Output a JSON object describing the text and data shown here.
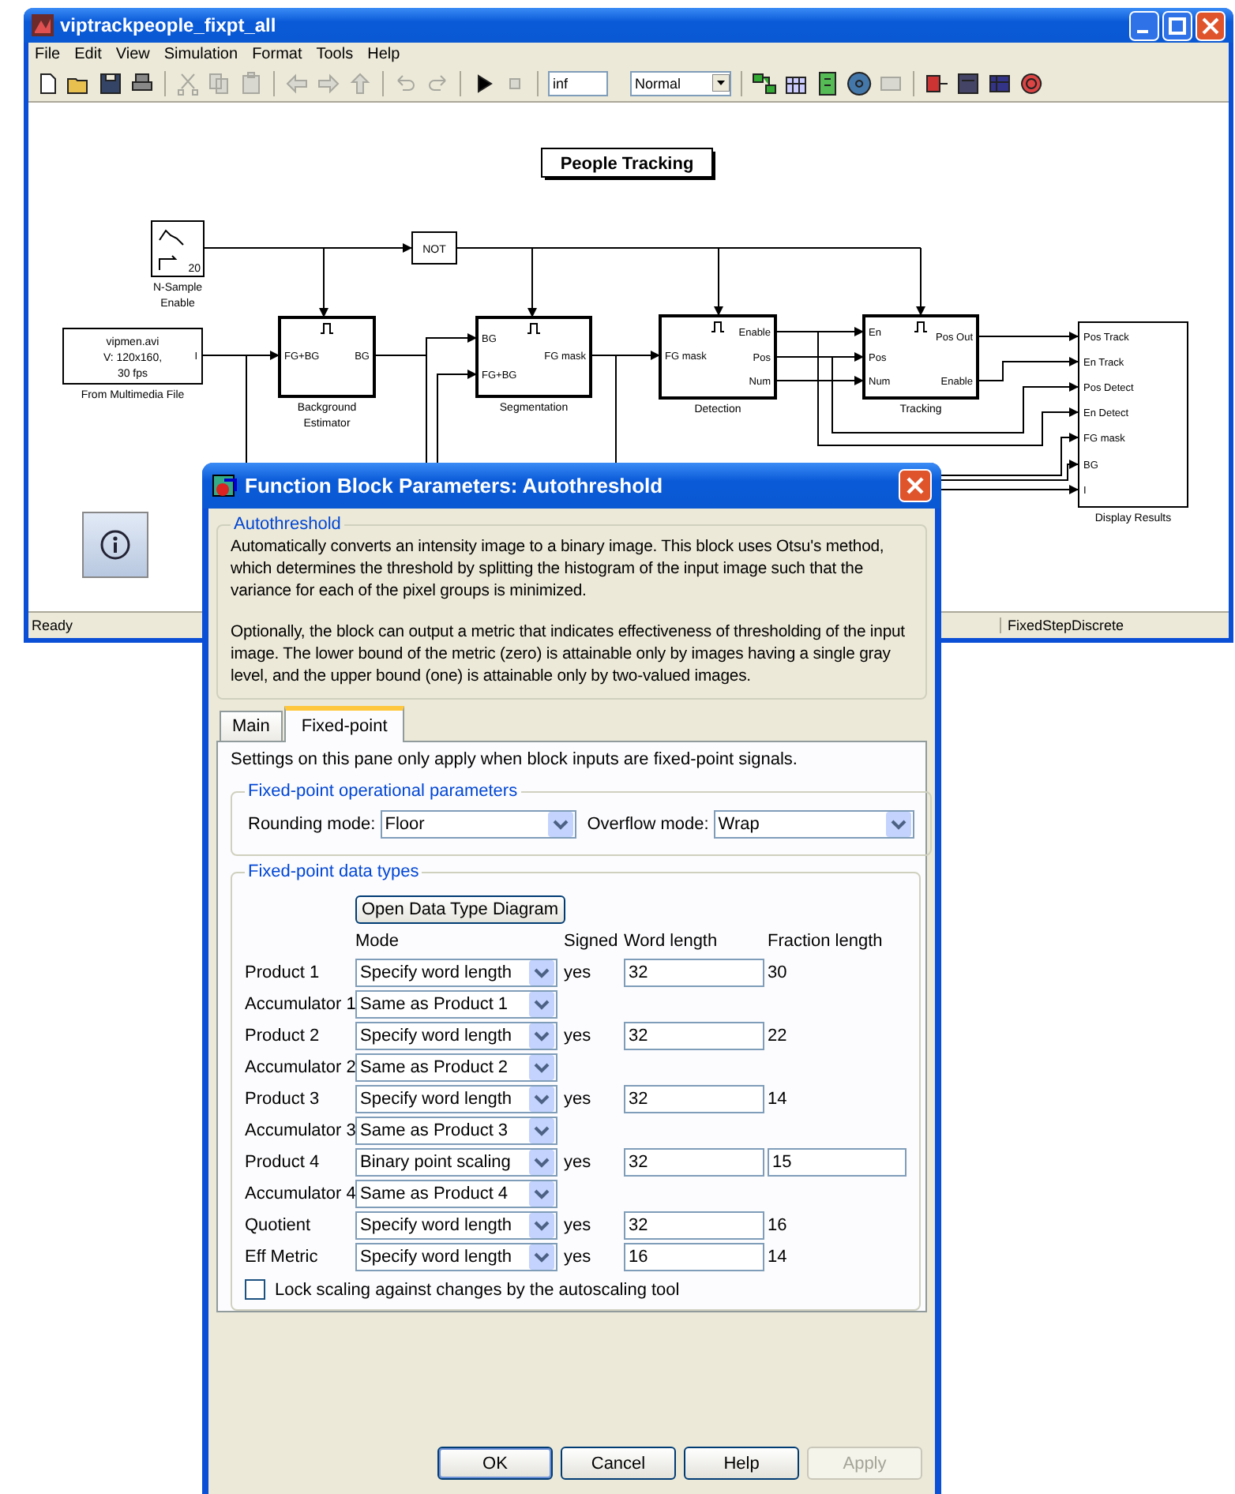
{
  "window": {
    "title": "viptrackpeople_fixpt_all"
  },
  "menu": [
    "File",
    "Edit",
    "View",
    "Simulation",
    "Format",
    "Tools",
    "Help"
  ],
  "toolbar": {
    "buttons": [
      {
        "disabled": false
      },
      {
        "disabled": false
      },
      {
        "disabled": false
      },
      {
        "disabled": false
      },
      {
        "disabled": true
      },
      {
        "disabled": true
      },
      {
        "disabled": true
      },
      {
        "disabled": true
      },
      {
        "disabled": true
      },
      {
        "disabled": true
      },
      {
        "disabled": true
      },
      {
        "disabled": true
      },
      {
        "disabled": false
      },
      {
        "disabled": true
      },
      {
        "disabled": false
      },
      {
        "disabled": false
      },
      {
        "disabled": false
      },
      {
        "disabled": false
      },
      {
        "disabled": true
      },
      {
        "disabled": false
      },
      {
        "disabled": false
      },
      {
        "disabled": false
      },
      {
        "disabled": false
      }
    ],
    "stop_time": "inf",
    "sim_mode": "Normal"
  },
  "diagram": {
    "annotation": "People Tracking",
    "blocks": [
      {
        "kind": "switch",
        "content": [
          "20"
        ],
        "caption": [
          "N-Sample",
          "Enable"
        ]
      },
      {
        "kind": "logic",
        "content": [
          "NOT"
        ]
      },
      {
        "kind": "source",
        "content": [
          "vipmen.avi",
          "V: 120x160,",
          "30 fps"
        ],
        "outputs": [
          "I"
        ],
        "caption": [
          "From Multimedia File"
        ]
      },
      {
        "kind": "subsystem",
        "enabled": true,
        "inputs": [
          "FG+BG"
        ],
        "outputs": [
          "BG"
        ],
        "caption": [
          "Background",
          "Estimator"
        ]
      },
      {
        "kind": "subsystem",
        "enabled": true,
        "inputs": [
          "BG",
          "FG+BG"
        ],
        "outputs": [
          "FG mask"
        ],
        "caption": [
          "Segmentation"
        ]
      },
      {
        "kind": "subsystem",
        "enabled": true,
        "inputs": [
          "FG mask"
        ],
        "outputs": [
          "Enable",
          "Pos",
          "Num"
        ],
        "caption": [
          "Detection"
        ]
      },
      {
        "kind": "subsystem",
        "enabled": true,
        "inputs": [
          "En",
          "Pos",
          "Num"
        ],
        "outputs": [
          "Pos Out",
          "Enable"
        ],
        "caption": [
          "Tracking"
        ]
      },
      {
        "kind": "sink",
        "inputs": [
          "Pos Track",
          "En Track",
          "Pos Detect",
          "En Detect",
          "FG mask",
          "BG",
          "I"
        ],
        "caption": [
          "Display Results"
        ]
      }
    ]
  },
  "status_bar": {
    "left": "Ready",
    "right": "FixedStepDiscrete"
  },
  "dialog": {
    "title": "Function Block Parameters: Autothreshold",
    "group_title": "Autothreshold",
    "paragraphs": [
      "Automatically converts an intensity image to a binary image.  This block uses Otsu's method, which determines the threshold by splitting the histogram of the input image such that the variance for each of the pixel groups is minimized.",
      "Optionally, the block can output a metric that indicates effectiveness of thresholding of the input image.  The lower bound of the metric (zero) is attainable only by images having a single gray level, and the upper bound (one) is attainable only by two-valued images."
    ],
    "tabs": [
      {
        "label": "Main",
        "selected": false
      },
      {
        "label": "Fixed-point",
        "selected": true
      }
    ],
    "note": "Settings on this pane only apply when block inputs are fixed-point signals.",
    "operational": {
      "title": "Fixed-point operational parameters",
      "fields": [
        {
          "label": "Rounding mode:",
          "value": "Floor"
        },
        {
          "label": "Overflow mode:",
          "value": "Wrap"
        }
      ]
    },
    "data_types": {
      "title": "Fixed-point data types",
      "diagram_button": "Open Data Type Diagram",
      "columns": [
        "Mode",
        "Signed",
        "Word length",
        "Fraction length"
      ],
      "rows": [
        {
          "label": "Product 1",
          "mode": "Specify word length",
          "signed": "yes",
          "word_length": "32",
          "fraction_length": "30",
          "fraction_editable": false
        },
        {
          "label": "Accumulator 1",
          "mode": "Same as Product 1"
        },
        {
          "label": "Product 2",
          "mode": "Specify word length",
          "signed": "yes",
          "word_length": "32",
          "fraction_length": "22",
          "fraction_editable": false
        },
        {
          "label": "Accumulator 2",
          "mode": "Same as Product 2"
        },
        {
          "label": "Product 3",
          "mode": "Specify word length",
          "signed": "yes",
          "word_length": "32",
          "fraction_length": "14",
          "fraction_editable": false
        },
        {
          "label": "Accumulator 3",
          "mode": "Same as Product 3"
        },
        {
          "label": "Product 4",
          "mode": "Binary point scaling",
          "signed": "yes",
          "word_length": "32",
          "fraction_length": "15",
          "fraction_editable": true
        },
        {
          "label": "Accumulator 4",
          "mode": "Same as Product 4"
        },
        {
          "label": "Quotient",
          "mode": "Specify word length",
          "signed": "yes",
          "word_length": "32",
          "fraction_length": "16",
          "fraction_editable": false
        },
        {
          "label": "Eff Metric",
          "mode": "Specify word length",
          "signed": "yes",
          "word_length": "16",
          "fraction_length": "14",
          "fraction_editable": false
        }
      ]
    },
    "lock": {
      "label": "Lock scaling against changes by the autoscaling tool",
      "checked": false
    },
    "buttons": [
      {
        "label": "OK",
        "default": true,
        "disabled": false
      },
      {
        "label": "Cancel",
        "default": false,
        "disabled": false
      },
      {
        "label": "Help",
        "default": false,
        "disabled": false
      },
      {
        "label": "Apply",
        "default": false,
        "disabled": true
      }
    ]
  }
}
